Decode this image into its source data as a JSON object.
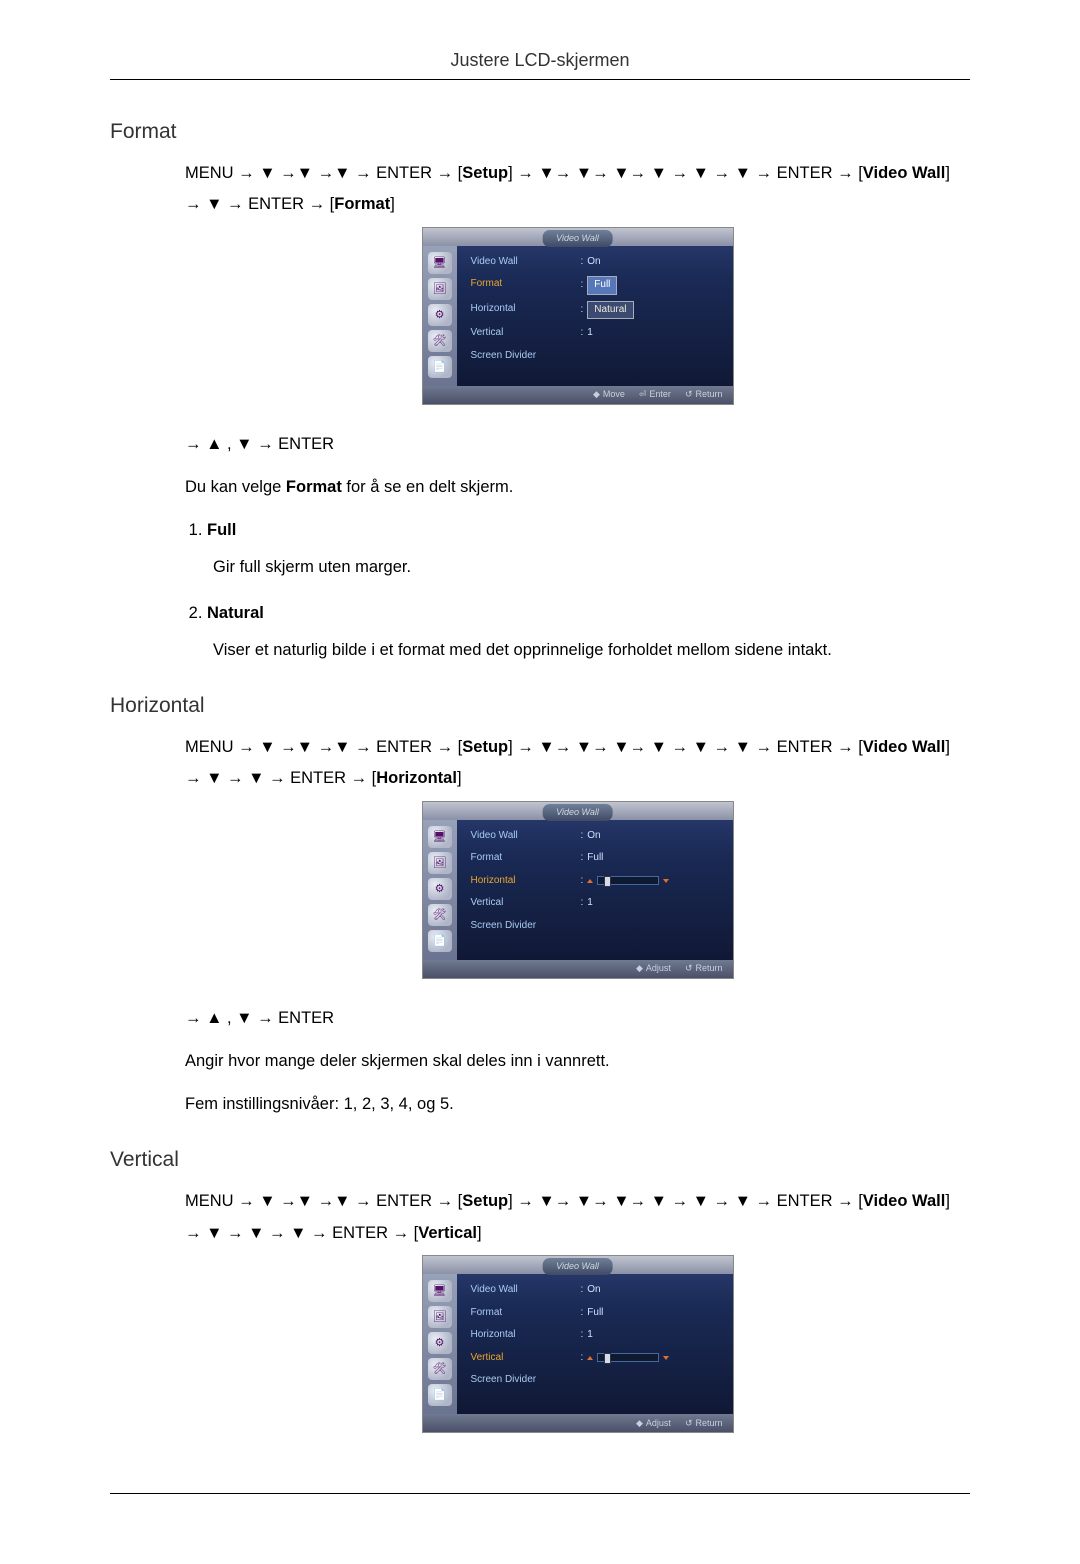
{
  "header": {
    "title": "Justere LCD-skjermen"
  },
  "symbols": {
    "arrow": "→",
    "down": "▼",
    "up": "▲"
  },
  "keys": {
    "menu": "MENU",
    "enter": "ENTER"
  },
  "bracketed": {
    "setup": "Setup",
    "video_wall": "Video Wall",
    "format": "Format",
    "horizontal": "Horizontal",
    "vertical": "Vertical"
  },
  "post_nav_line": "→ ▲ , ▼ → ENTER",
  "sections": {
    "format": {
      "heading": "Format",
      "path_line_1": "MENU → ▼ →▼ →▼ → ENTER → [",
      "path_mid_1": "] → ▼→ ▼→ ▼→ ▼ → ▼ → ▼ → ENTER → [",
      "path_end_1": "]",
      "path_line_2_pre": "→ ▼ → ENTER → [",
      "path_line_2_post": "]",
      "intro": "Du kan velge Format for å se en delt skjerm.",
      "intro_pre": "Du kan velge ",
      "intro_bold": "Format",
      "intro_post": " for å se en delt skjerm.",
      "items": [
        {
          "title": "Full",
          "desc": "Gir full skjerm uten marger."
        },
        {
          "title": "Natural",
          "desc": "Viser et naturlig bilde i et format med det opprinnelige forholdet mellom sidene intakt."
        }
      ]
    },
    "horizontal": {
      "heading": "Horizontal",
      "path_line_1": "MENU → ▼ →▼ →▼ → ENTER → [",
      "path_mid_1": "] → ▼→ ▼→ ▼→ ▼ → ▼ → ▼ → ENTER → [",
      "path_end_1": "]",
      "path_line_2_pre": "→ ▼ → ▼ → ENTER → [",
      "path_line_2_post": "]",
      "para1": "Angir hvor mange deler skjermen skal deles inn i vannrett.",
      "para2": "Fem instillingsnivåer: 1, 2, 3, 4, og 5."
    },
    "vertical": {
      "heading": "Vertical",
      "path_line_1": "MENU → ▼ →▼ →▼ → ENTER → [",
      "path_mid_1": "] → ▼→ ▼→ ▼→ ▼ → ▼ → ▼ → ENTER → [",
      "path_end_1": "]",
      "path_line_2_pre": "→ ▼ → ▼ → ▼ → ENTER → [",
      "path_line_2_post": "]"
    }
  },
  "osd": {
    "title": "Video Wall",
    "labels": {
      "video_wall": "Video Wall",
      "format": "Format",
      "horizontal": "Horizontal",
      "vertical": "Vertical",
      "screen_divider": "Screen Divider"
    },
    "values": {
      "on": "On",
      "full": "Full",
      "natural": "Natural",
      "one": "1"
    },
    "nav": {
      "move": "Move",
      "enter": "Enter",
      "return": "Return",
      "adjust": "Adjust"
    },
    "nav_icons": {
      "updown": "◆",
      "enter": "⏎",
      "return": "↺"
    },
    "side_icons": [
      "🖥",
      "🖼",
      "⚙",
      "🛠",
      "📄"
    ]
  }
}
